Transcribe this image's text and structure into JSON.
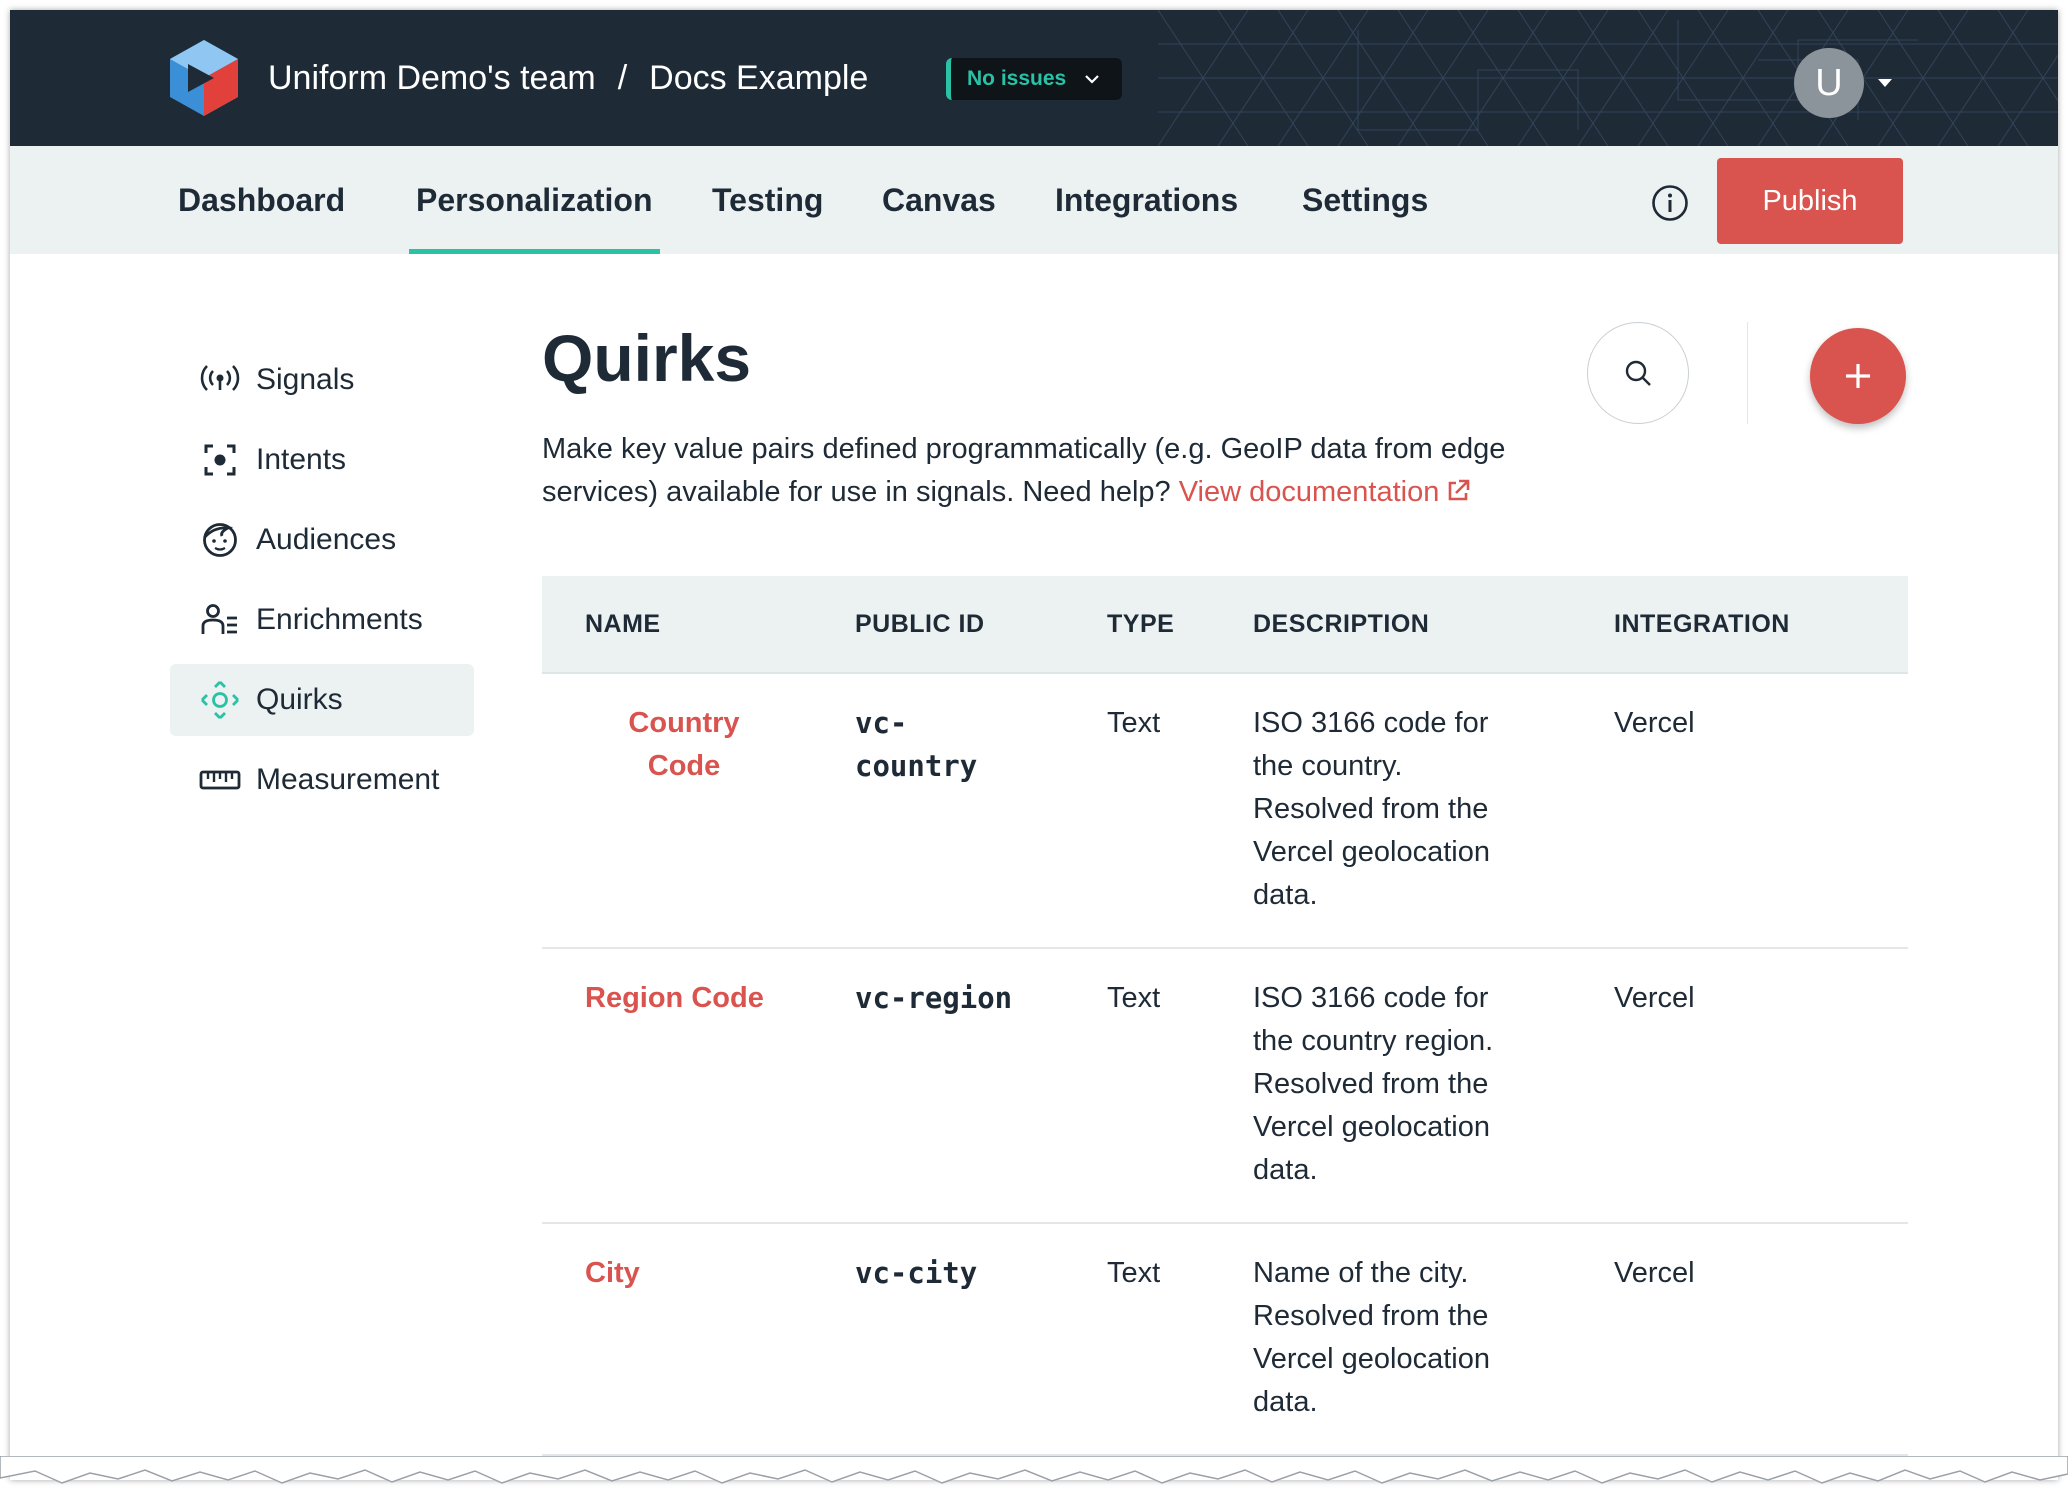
{
  "header": {
    "team_name": "Uniform Demo's team",
    "separator": "/",
    "project_name": "Docs Example",
    "status": "No issues",
    "avatar_initial": "U"
  },
  "nav": {
    "tabs": [
      "Dashboard",
      "Personalization",
      "Testing",
      "Canvas",
      "Integrations",
      "Settings"
    ],
    "active_tab": "Personalization",
    "publish_label": "Publish"
  },
  "sidebar": {
    "items": [
      {
        "label": "Signals",
        "icon": "signal-broadcast-icon"
      },
      {
        "label": "Intents",
        "icon": "focus-target-icon"
      },
      {
        "label": "Audiences",
        "icon": "face-icon"
      },
      {
        "label": "Enrichments",
        "icon": "user-list-icon"
      },
      {
        "label": "Quirks",
        "icon": "quirks-diamond-icon"
      },
      {
        "label": "Measurement",
        "icon": "ruler-icon"
      }
    ],
    "active_item": "Quirks"
  },
  "page": {
    "title": "Quirks",
    "description_line1": "Make key value pairs defined programmatically (e.g. GeoIP data from edge",
    "description_line2": "services) available for use in signals. Need help?",
    "doc_link": "View documentation"
  },
  "table": {
    "columns": [
      "NAME",
      "PUBLIC ID",
      "TYPE",
      "DESCRIPTION",
      "INTEGRATION"
    ],
    "rows": [
      {
        "name_lines": [
          "Country",
          "Code"
        ],
        "public_id_lines": [
          "vc-",
          "country"
        ],
        "type": "Text",
        "description_lines": [
          "ISO 3166 code for",
          "the country.",
          "Resolved from the",
          "Vercel geolocation",
          "data."
        ],
        "integration": "Vercel"
      },
      {
        "name_lines": [
          "Region Code"
        ],
        "public_id_lines": [
          "vc-region"
        ],
        "type": "Text",
        "description_lines": [
          "ISO 3166 code for",
          "the country region.",
          "Resolved from the",
          "Vercel geolocation",
          "data."
        ],
        "integration": "Vercel"
      },
      {
        "name_lines": [
          "City"
        ],
        "public_id_lines": [
          "vc-city"
        ],
        "type": "Text",
        "description_lines": [
          "Name of the city.",
          "Resolved from the",
          "Vercel geolocation",
          "data."
        ],
        "integration": "Vercel"
      }
    ]
  },
  "colors": {
    "header_bg": "#1e2a36",
    "accent_teal": "#2bc1a5",
    "primary_red": "#d9534f",
    "nav_bg": "#ecf1f2"
  }
}
